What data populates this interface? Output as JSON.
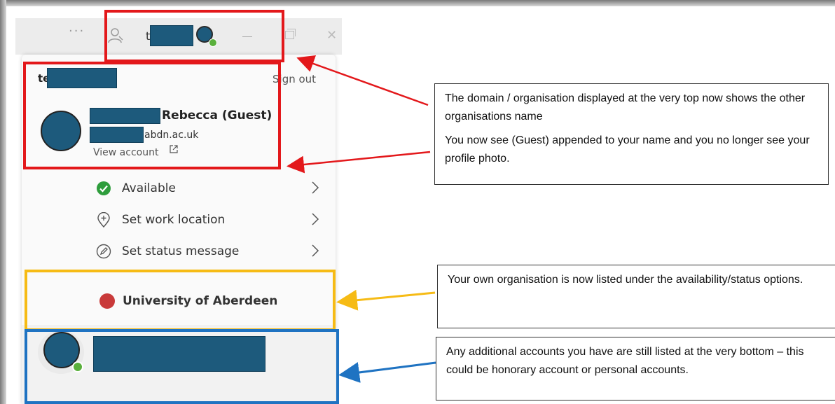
{
  "titlebar": {
    "more_label": "···",
    "org_initial": "t",
    "close_label": "✕"
  },
  "profile": {
    "org_initial": "te",
    "sign_out": "Sign out",
    "name": "Rebecca (Guest)",
    "email_suffix": "abdn.ac.uk",
    "view_account": "View account"
  },
  "menu": {
    "items": [
      {
        "label": "Available",
        "icon": "available-check-icon"
      },
      {
        "label": "Set work location",
        "icon": "location-plus-icon"
      },
      {
        "label": "Set status message",
        "icon": "pencil-icon"
      }
    ]
  },
  "own_org": {
    "label": "University of Aberdeen"
  },
  "callouts": {
    "top": {
      "p1": "The domain / organisation displayed at the very top now shows the other organisations name",
      "p2": "You now see (Guest) appended to your name and you no longer see your profile photo."
    },
    "middle": {
      "p1": "Your own organisation is now listed under the availability/status options."
    },
    "bottom": {
      "p1": "Any additional accounts you have are still listed at the very bottom – this could be honorary account or personal accounts."
    }
  },
  "colors": {
    "redaction": "#1d5a7c",
    "highlight_red": "#e3181b",
    "highlight_yellow": "#f6bb15",
    "highlight_blue": "#1f73c2",
    "status_green": "#5ab03c",
    "org_dot_red": "#c93a3a"
  }
}
